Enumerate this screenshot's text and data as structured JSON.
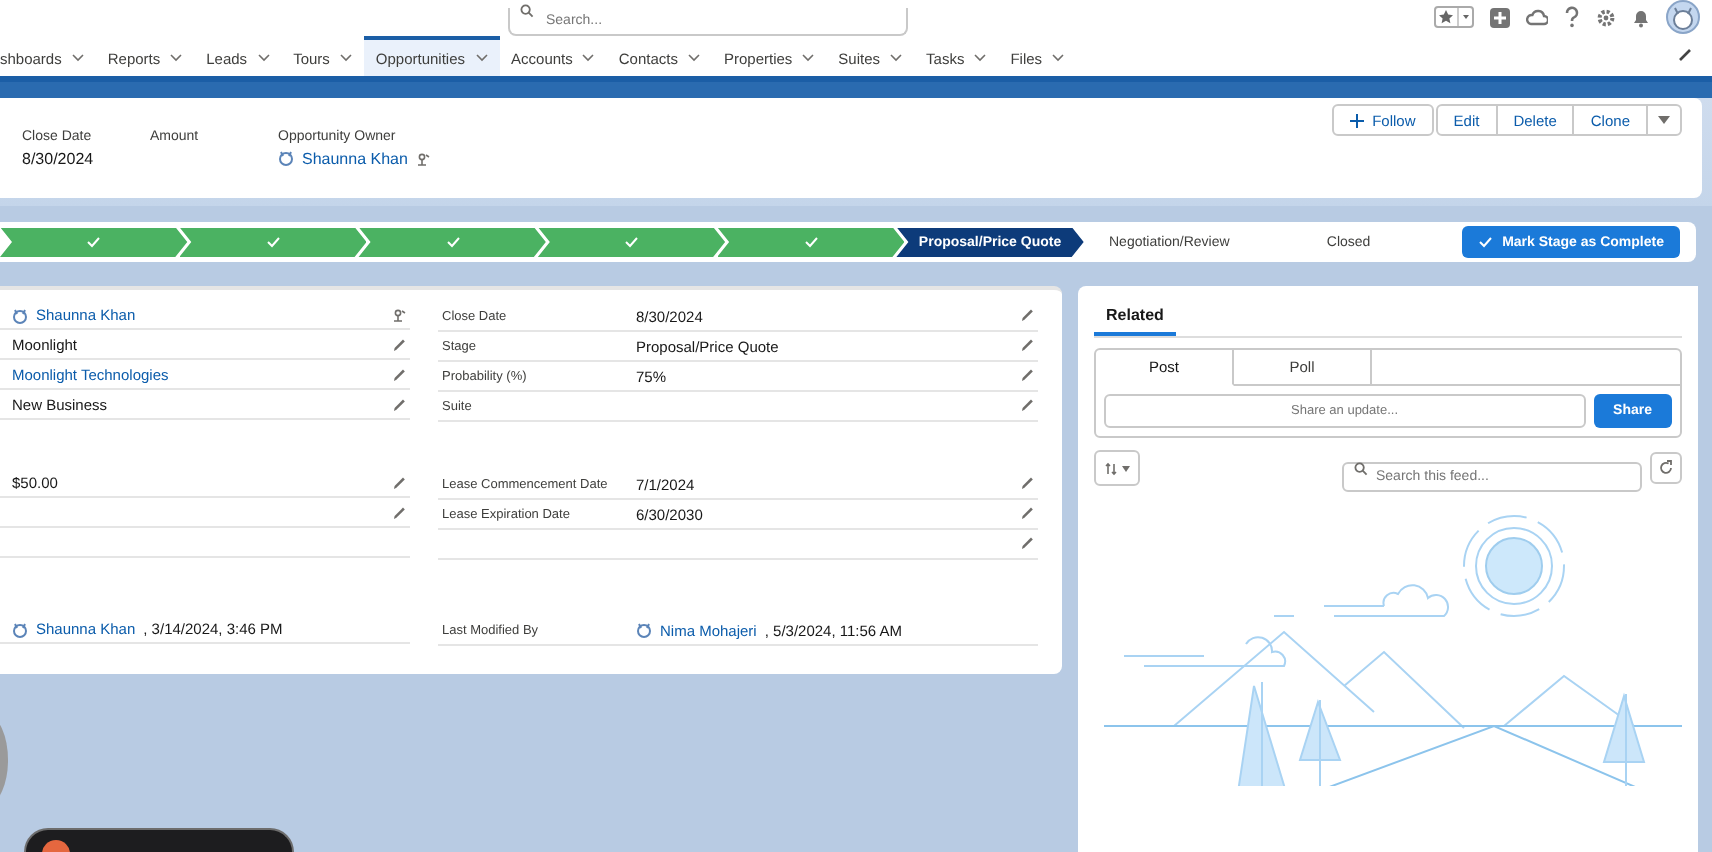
{
  "header": {
    "search": {
      "placeholder": "Search..."
    }
  },
  "nav": {
    "tabs": [
      {
        "label": "shboards",
        "selected": false
      },
      {
        "label": "Reports",
        "selected": false
      },
      {
        "label": "Leads",
        "selected": false
      },
      {
        "label": "Tours",
        "selected": false
      },
      {
        "label": "Opportunities",
        "selected": true
      },
      {
        "label": "Accounts",
        "selected": false
      },
      {
        "label": "Contacts",
        "selected": false
      },
      {
        "label": "Properties",
        "selected": false
      },
      {
        "label": "Suites",
        "selected": false
      },
      {
        "label": "Tasks",
        "selected": false
      },
      {
        "label": "Files",
        "selected": false
      }
    ]
  },
  "actions": [
    {
      "label": "Follow",
      "kind": "follow"
    },
    {
      "label": "Edit",
      "kind": "plain"
    },
    {
      "label": "Delete",
      "kind": "plain"
    },
    {
      "label": "Clone",
      "kind": "plain"
    },
    {
      "kind": "menu"
    }
  ],
  "highlights": [
    {
      "label": "Close Date",
      "value": "8/30/2024"
    },
    {
      "label": "Amount"
    },
    {
      "label": "Opportunity Owner",
      "link": "Shaunna Khan",
      "avatar": true,
      "change_owner": true
    }
  ],
  "path": {
    "stages": [
      {
        "kind": "complete"
      },
      {
        "kind": "complete"
      },
      {
        "kind": "complete"
      },
      {
        "kind": "complete"
      },
      {
        "kind": "complete"
      },
      {
        "label": "Proposal/Price Quote",
        "kind": "current"
      },
      {
        "label": "Negotiation/Review",
        "kind": "incomplete"
      },
      {
        "label": "Closed",
        "kind": "incomplete"
      }
    ],
    "button": "Mark Stage as Complete"
  },
  "details": {
    "sections": [
      {
        "rows": [
          [
            {
              "link": "Shaunna Khan",
              "avatar": true,
              "change_owner": true
            },
            {
              "label": "Close Date",
              "value": "8/30/2024",
              "editable": true
            }
          ],
          [
            {
              "value": "Moonlight",
              "editable": true
            },
            {
              "label": "Stage",
              "value": "Proposal/Price Quote",
              "editable": true
            }
          ],
          [
            {
              "link": "Moonlight Technologies",
              "editable": true
            },
            {
              "label": "Probability (%)",
              "value": "75%",
              "editable": true
            }
          ],
          [
            {
              "value": "New Business",
              "editable": true
            },
            {
              "label": "Suite",
              "editable": true
            }
          ]
        ]
      },
      {
        "rows": [
          [
            {
              "value": "$50.00",
              "editable": true
            },
            {
              "label": "Lease Commencement Date",
              "value": "7/1/2024",
              "editable": true
            }
          ],
          [
            {
              "editable": true
            },
            {
              "label": "Lease Expiration Date",
              "value": "6/30/2030",
              "editable": true
            }
          ],
          [
            {
              "editable": false
            },
            {
              "editable": true
            }
          ]
        ]
      },
      {
        "rows": [
          [
            {
              "link": "Shaunna Khan",
              "avatar": true,
              "suffix": ", 3/14/2024, 3:46 PM"
            },
            {
              "label": "Last Modified By",
              "link": "Nima Mohajeri",
              "avatar": true,
              "suffix": ", 5/3/2024, 11:56 AM"
            }
          ]
        ]
      }
    ]
  },
  "related": {
    "tabs": [
      {
        "label": "Related",
        "selected": true
      }
    ],
    "publisher": {
      "tabs": [
        {
          "label": "Post",
          "selected": true
        },
        {
          "label": "Poll",
          "selected": false
        }
      ],
      "placeholder": "Share an update...",
      "button": "Share"
    },
    "feed_search": {
      "placeholder": "Search this feed..."
    }
  }
}
